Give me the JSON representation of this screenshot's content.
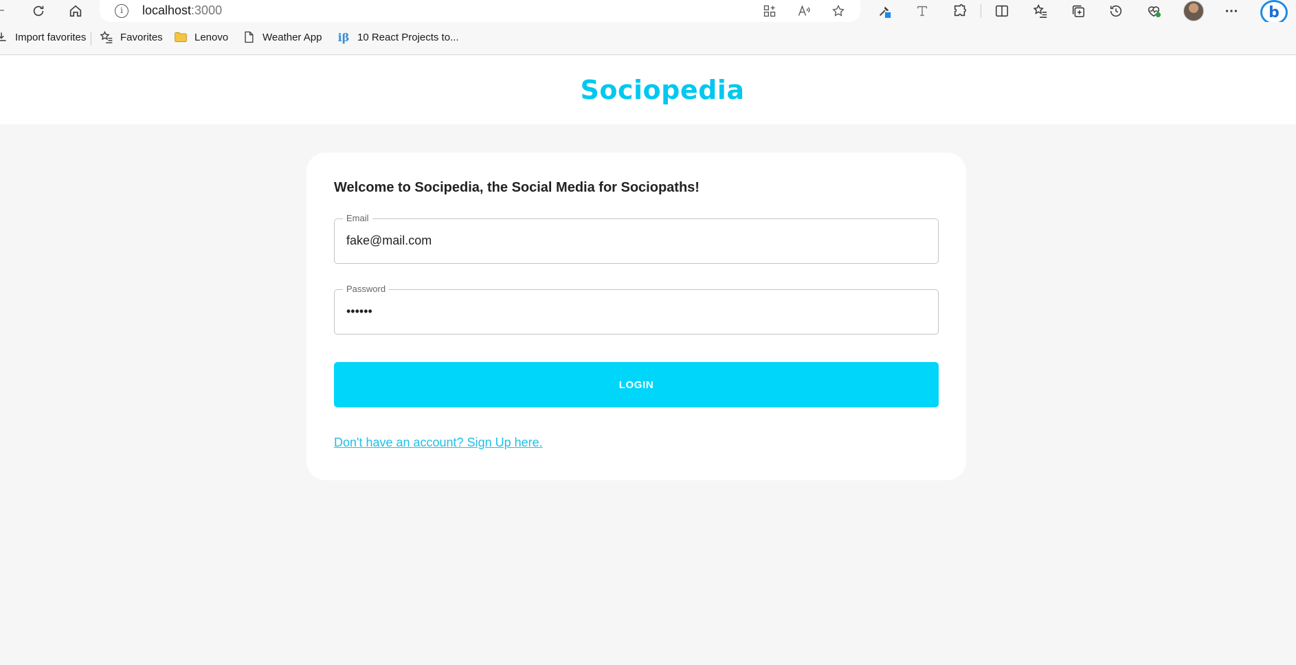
{
  "browser": {
    "url_host": "localhost",
    "url_port": ":3000",
    "favorites": [
      {
        "label": "Import favorites",
        "icon": "import-icon"
      },
      {
        "label": "Favorites",
        "icon": "favorites-star-icon"
      },
      {
        "label": "Lenovo",
        "icon": "folder-icon"
      },
      {
        "label": "Weather App",
        "icon": "page-icon"
      },
      {
        "label": "10 React Projects to...",
        "icon": "ib-icon",
        "icon_text": "iβ"
      }
    ],
    "bing_letter": "b"
  },
  "app": {
    "logo": "Sociopedia",
    "brand_color": "#00c8ef"
  },
  "login_form": {
    "welcome": "Welcome to Socipedia, the Social Media for Sociopaths!",
    "email_label": "Email",
    "email_value": "fake@mail.com",
    "password_label": "Password",
    "password_value": "••••••",
    "submit_label": "LOGIN",
    "signup_link": "Don't have an account? Sign Up here.",
    "button_color": "#00d5fa"
  }
}
